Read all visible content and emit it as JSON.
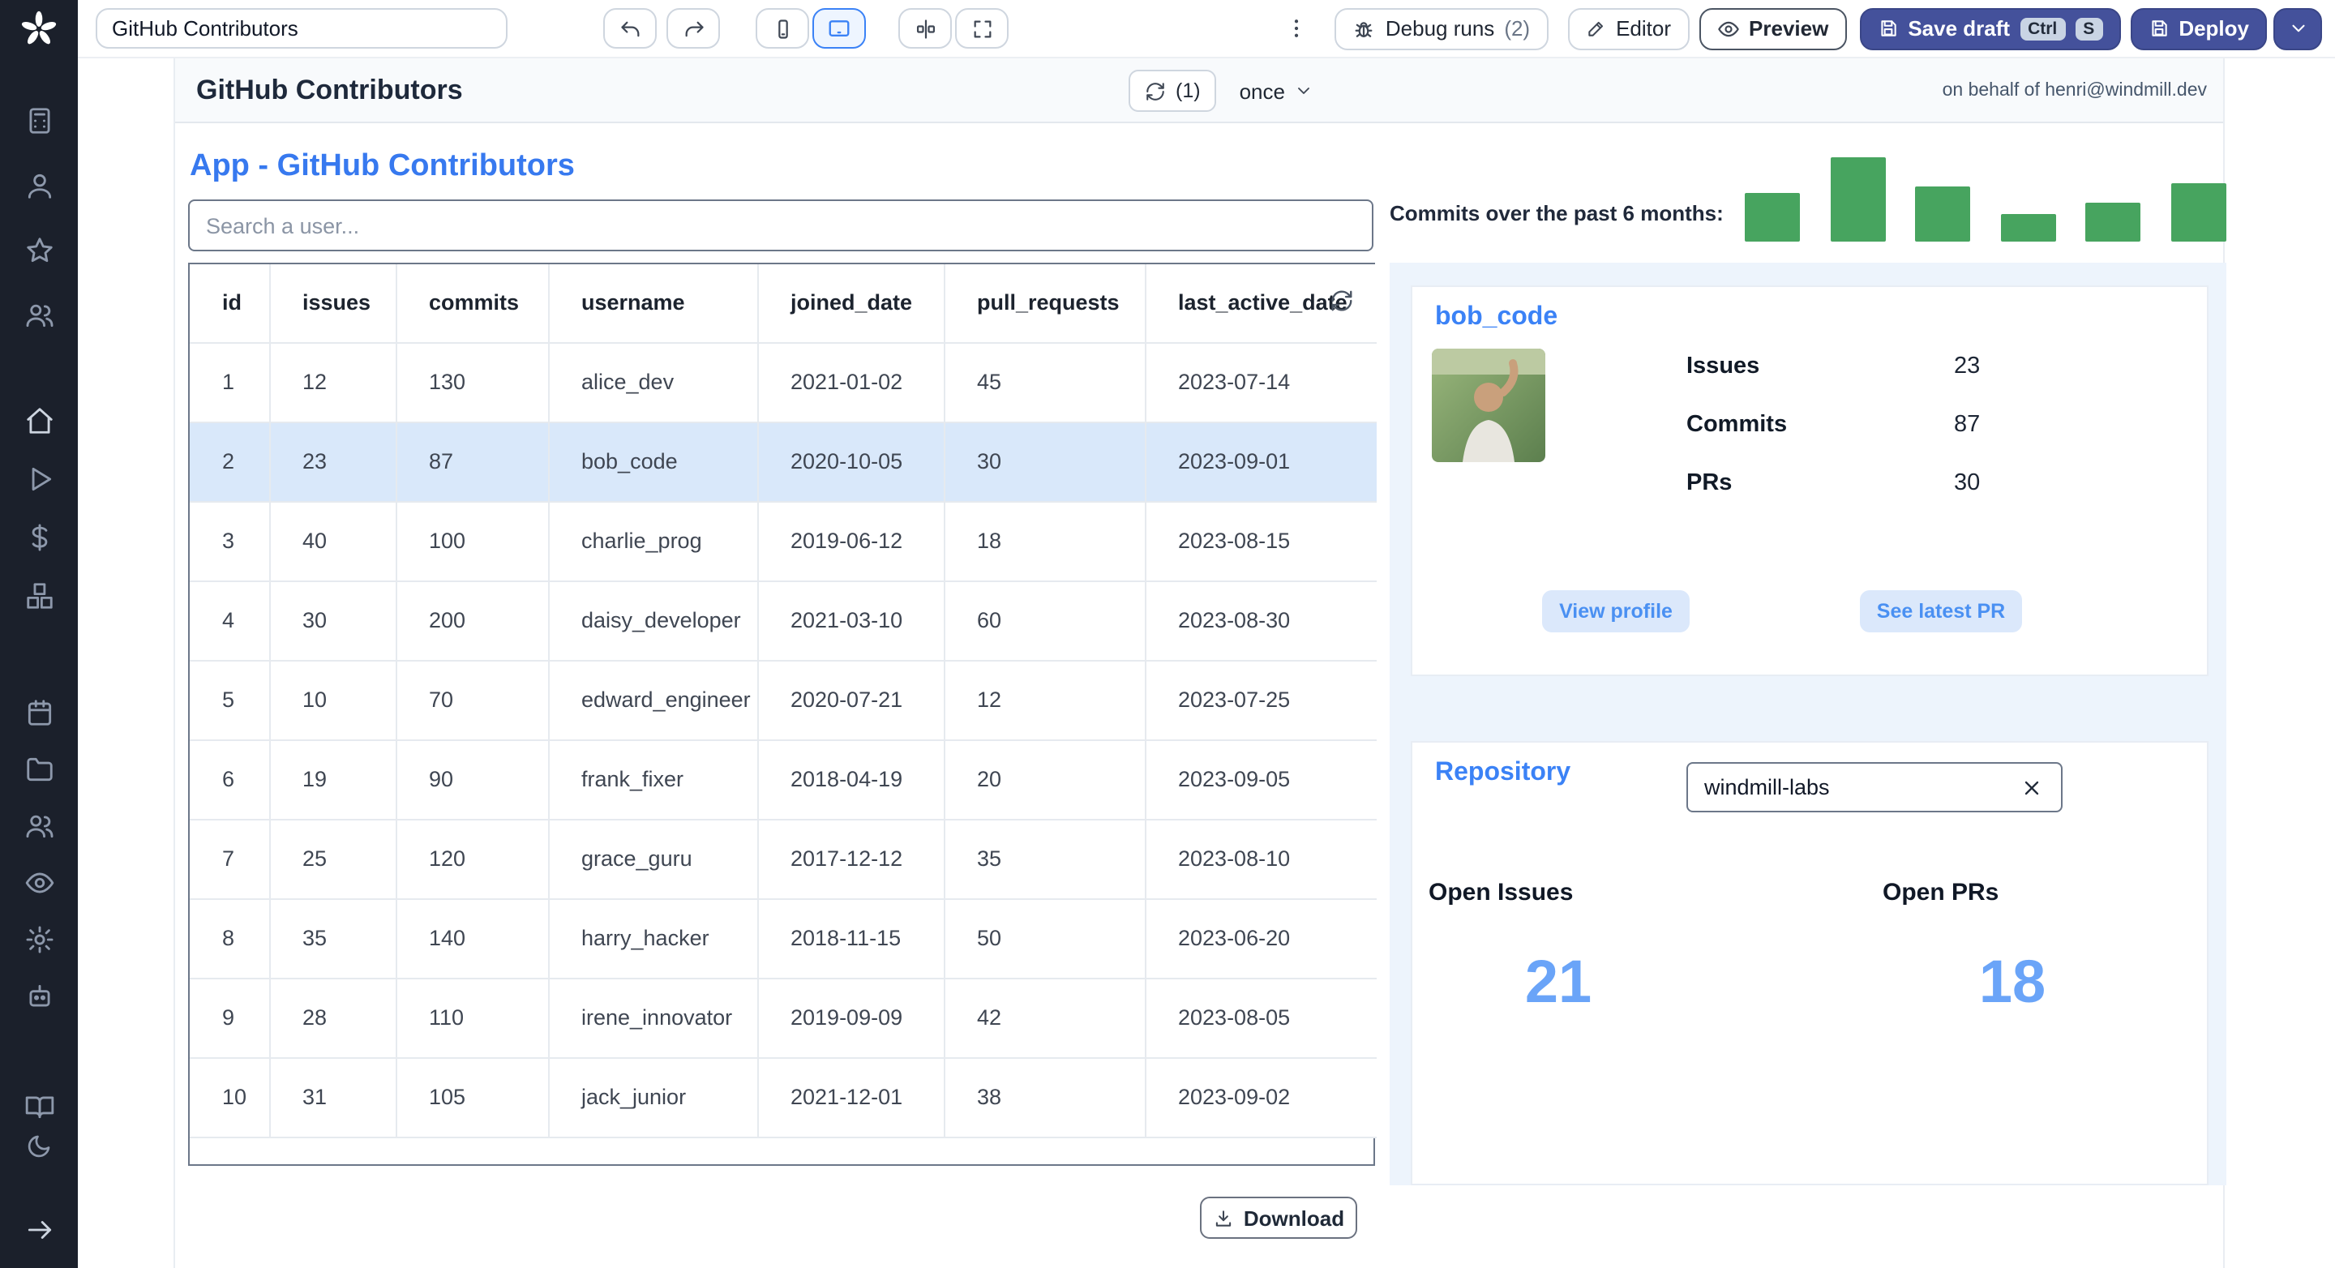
{
  "topbar": {
    "app_name": "GitHub Contributors",
    "debug_runs": "Debug runs",
    "debug_count": "(2)",
    "editor": "Editor",
    "preview": "Preview",
    "save_draft": "Save draft",
    "kbd_ctrl": "Ctrl",
    "kbd_s": "S",
    "deploy": "Deploy"
  },
  "header": {
    "title": "GitHub Contributors",
    "refresh_count": "(1)",
    "schedule": "once",
    "on_behalf": "on behalf of henri@windmill.dev"
  },
  "main": {
    "page_title": "App - GitHub Contributors",
    "search_placeholder": "Search a user...",
    "download": "Download",
    "table": {
      "columns": [
        "id",
        "issues",
        "commits",
        "username",
        "joined_date",
        "pull_requests",
        "last_active_date"
      ],
      "rows": [
        [
          1,
          12,
          130,
          "alice_dev",
          "2021-01-02",
          45,
          "2023-07-14"
        ],
        [
          2,
          23,
          87,
          "bob_code",
          "2020-10-05",
          30,
          "2023-09-01"
        ],
        [
          3,
          40,
          100,
          "charlie_prog",
          "2019-06-12",
          18,
          "2023-08-15"
        ],
        [
          4,
          30,
          200,
          "daisy_developer",
          "2021-03-10",
          60,
          "2023-08-30"
        ],
        [
          5,
          10,
          70,
          "edward_engineer",
          "2020-07-21",
          12,
          "2023-07-25"
        ],
        [
          6,
          19,
          90,
          "frank_fixer",
          "2018-04-19",
          20,
          "2023-09-05"
        ],
        [
          7,
          25,
          120,
          "grace_guru",
          "2017-12-12",
          35,
          "2023-08-10"
        ],
        [
          8,
          35,
          140,
          "harry_hacker",
          "2018-11-15",
          50,
          "2023-06-20"
        ],
        [
          9,
          28,
          110,
          "irene_innovator",
          "2019-09-09",
          42,
          "2023-08-05"
        ],
        [
          10,
          31,
          105,
          "jack_junior",
          "2021-12-01",
          38,
          "2023-09-02"
        ]
      ],
      "selected_row": 1
    }
  },
  "panel": {
    "commits_label": "Commits over the past 6 months:",
    "user": {
      "name": "bob_code",
      "stats": [
        {
          "label": "Issues",
          "value": "23"
        },
        {
          "label": "Commits",
          "value": "87"
        },
        {
          "label": "PRs",
          "value": "30"
        }
      ],
      "view_profile": "View profile",
      "see_latest_pr": "See latest PR"
    },
    "repo": {
      "title": "Repository",
      "value": "windmill-labs",
      "stats": [
        {
          "label": "Open Issues",
          "value": "21"
        },
        {
          "label": "Open PRs",
          "value": "18"
        }
      ]
    }
  },
  "chart_data": {
    "type": "bar",
    "title": "Commits over the past 6 months",
    "num_bars": 6,
    "values_relative": [
      0.57,
      1.0,
      0.65,
      0.32,
      0.46,
      0.7
    ],
    "bar_color": "#47a45f",
    "axis_labels_visible": false,
    "legend": "none"
  },
  "colors": {
    "accent_blue": "#3b82f6",
    "big_number_blue": "#6aa4f8",
    "selected_row": "#d9e8fa",
    "sidebar_bg": "#1b202b",
    "dark_button": "#44519b",
    "bar_green": "#47a45f",
    "panel_bg": "#edf4fc"
  },
  "icons": {
    "windmill-logo": "pinwheel",
    "undo-icon": "U+21B6",
    "redo-icon": "U+21B7",
    "mobile-icon": "phone",
    "desktop-icon": "tablet",
    "align-center-icon": "|0|",
    "maximize-icon": "corner-arrows",
    "kebab-menu-icon": "U+22EE",
    "bug-icon": "bug",
    "pencil-icon": "U+270E",
    "eye-icon": "eye",
    "save-icon": "floppy",
    "chevron-down-icon": "U+25BE",
    "refresh-icon": "U+27F3",
    "download-icon": "U+2B07",
    "close-icon": "U+2715",
    "home-icon": "house",
    "play-icon": "U+25B6",
    "dollar-icon": "$",
    "star-icon": "U+2605",
    "user-icon": "person",
    "users-icon": "people",
    "calculator-icon": "calculator",
    "boxes-icon": "boxes",
    "calendar-icon": "calendar",
    "folder-icon": "folder",
    "gear-icon": "U+2699",
    "robot-icon": "robot",
    "book-icon": "open-book",
    "moon-icon": "U+263E",
    "arrow-right-icon": "U+2192"
  }
}
